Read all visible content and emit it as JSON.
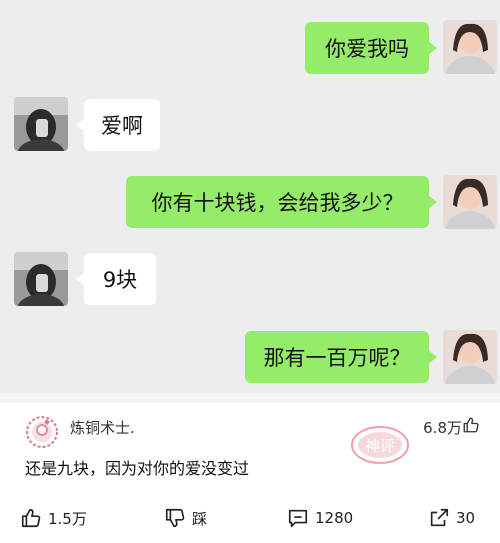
{
  "messages": [
    {
      "side": "right",
      "text": "你爱我吗"
    },
    {
      "side": "left",
      "text": "爱啊"
    },
    {
      "side": "right",
      "text": "你有十块钱，会给我多少？"
    },
    {
      "side": "left",
      "text": "9块"
    },
    {
      "side": "right",
      "text": "那有一百万呢？"
    }
  ],
  "comment": {
    "username": "炼铜术士.",
    "likes": "6.8万",
    "text": "还是九块，因为对你的爱没变过",
    "stamp": "神评"
  },
  "actions": {
    "like_count": "1.5万",
    "dislike_label": "踩",
    "comment_count": "1280",
    "share_count": "30"
  },
  "colors": {
    "chat_bg": "#ededed",
    "my_bubble": "#95ec69",
    "their_bubble": "#ffffff",
    "stamp_red": "#e0546a"
  }
}
